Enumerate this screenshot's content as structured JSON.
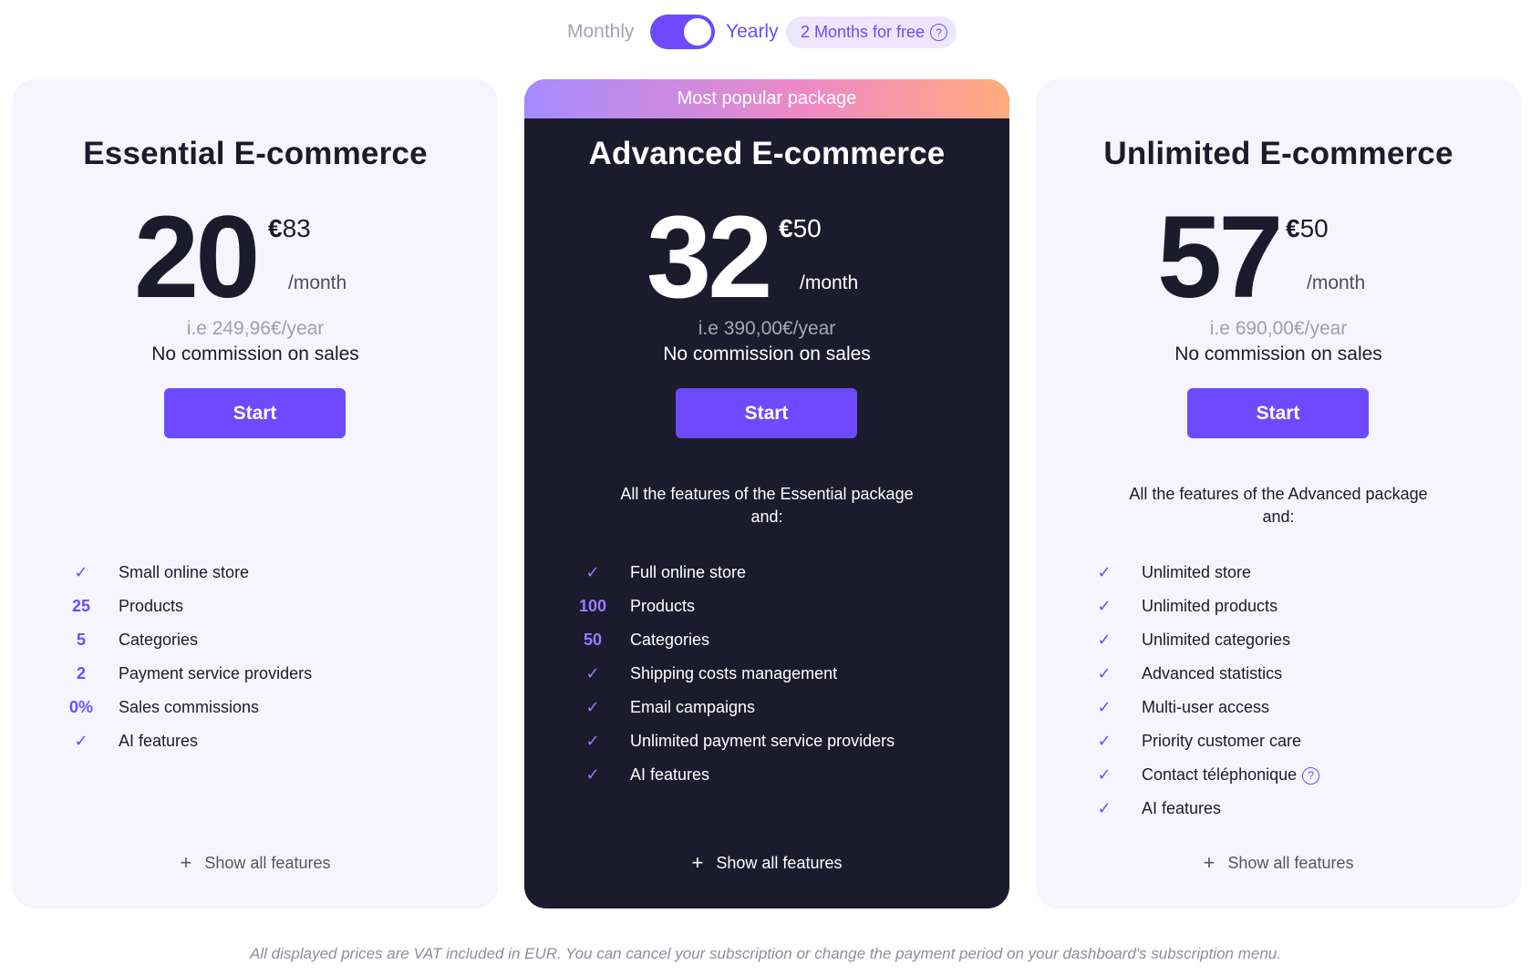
{
  "billing_toggle": {
    "monthly_label": "Monthly",
    "yearly_label": "Yearly",
    "selected": "Yearly",
    "promo_label": "2 Months for free"
  },
  "cards": [
    {
      "title": "Essential E-commerce",
      "price_whole": "20",
      "price_currency": "€",
      "price_cents": "83",
      "price_period": "/month",
      "yearly_note": "i.e 249,96€/year",
      "commission": "No commission on sales",
      "start_label": "Start",
      "intro": "",
      "features": [
        {
          "mark": "check",
          "label": "Small online store"
        },
        {
          "mark": "25",
          "label": "Products"
        },
        {
          "mark": "5",
          "label": "Categories"
        },
        {
          "mark": "2",
          "label": "Payment service providers"
        },
        {
          "mark": "0%",
          "label": "Sales commissions"
        },
        {
          "mark": "check",
          "label": "AI features"
        }
      ],
      "show_all_label": "Show all features"
    },
    {
      "banner": "Most popular package",
      "title": "Advanced E-commerce",
      "price_whole": "32",
      "price_currency": "€",
      "price_cents": "50",
      "price_period": "/month",
      "yearly_note": "i.e 390,00€/year",
      "commission": "No commission on sales",
      "start_label": "Start",
      "intro": "All the features of the Essential package and:",
      "features": [
        {
          "mark": "check",
          "label": "Full online store"
        },
        {
          "mark": "100",
          "label": "Products"
        },
        {
          "mark": "50",
          "label": "Categories"
        },
        {
          "mark": "check",
          "label": "Shipping costs management"
        },
        {
          "mark": "check",
          "label": "Email campaigns"
        },
        {
          "mark": "check",
          "label": "Unlimited payment service providers"
        },
        {
          "mark": "check",
          "label": "AI features"
        }
      ],
      "show_all_label": "Show all features"
    },
    {
      "title": "Unlimited E-commerce",
      "price_whole": "57",
      "price_currency": "€",
      "price_cents": "50",
      "price_period": "/month",
      "yearly_note": "i.e 690,00€/year",
      "commission": "No commission on sales",
      "start_label": "Start",
      "intro": "All the features of the Advanced package and:",
      "features": [
        {
          "mark": "check",
          "label": "Unlimited store"
        },
        {
          "mark": "check",
          "label": "Unlimited products"
        },
        {
          "mark": "check",
          "label": "Unlimited categories"
        },
        {
          "mark": "check",
          "label": "Advanced statistics"
        },
        {
          "mark": "check",
          "label": "Multi-user access"
        },
        {
          "mark": "check",
          "label": "Priority customer care"
        },
        {
          "mark": "check",
          "label": "Contact téléphonique",
          "help_icon": "question-circle-icon"
        },
        {
          "mark": "check",
          "label": "AI features"
        }
      ],
      "show_all_label": "Show all features"
    }
  ],
  "footer_note": "All displayed prices are VAT included in EUR. You can cancel your subscription or change the payment period on your dashboard's subscription menu.",
  "colors": {
    "accent": "#6d4aff",
    "dark_card": "#1c1b2e",
    "light_card": "#f6f5fd"
  }
}
